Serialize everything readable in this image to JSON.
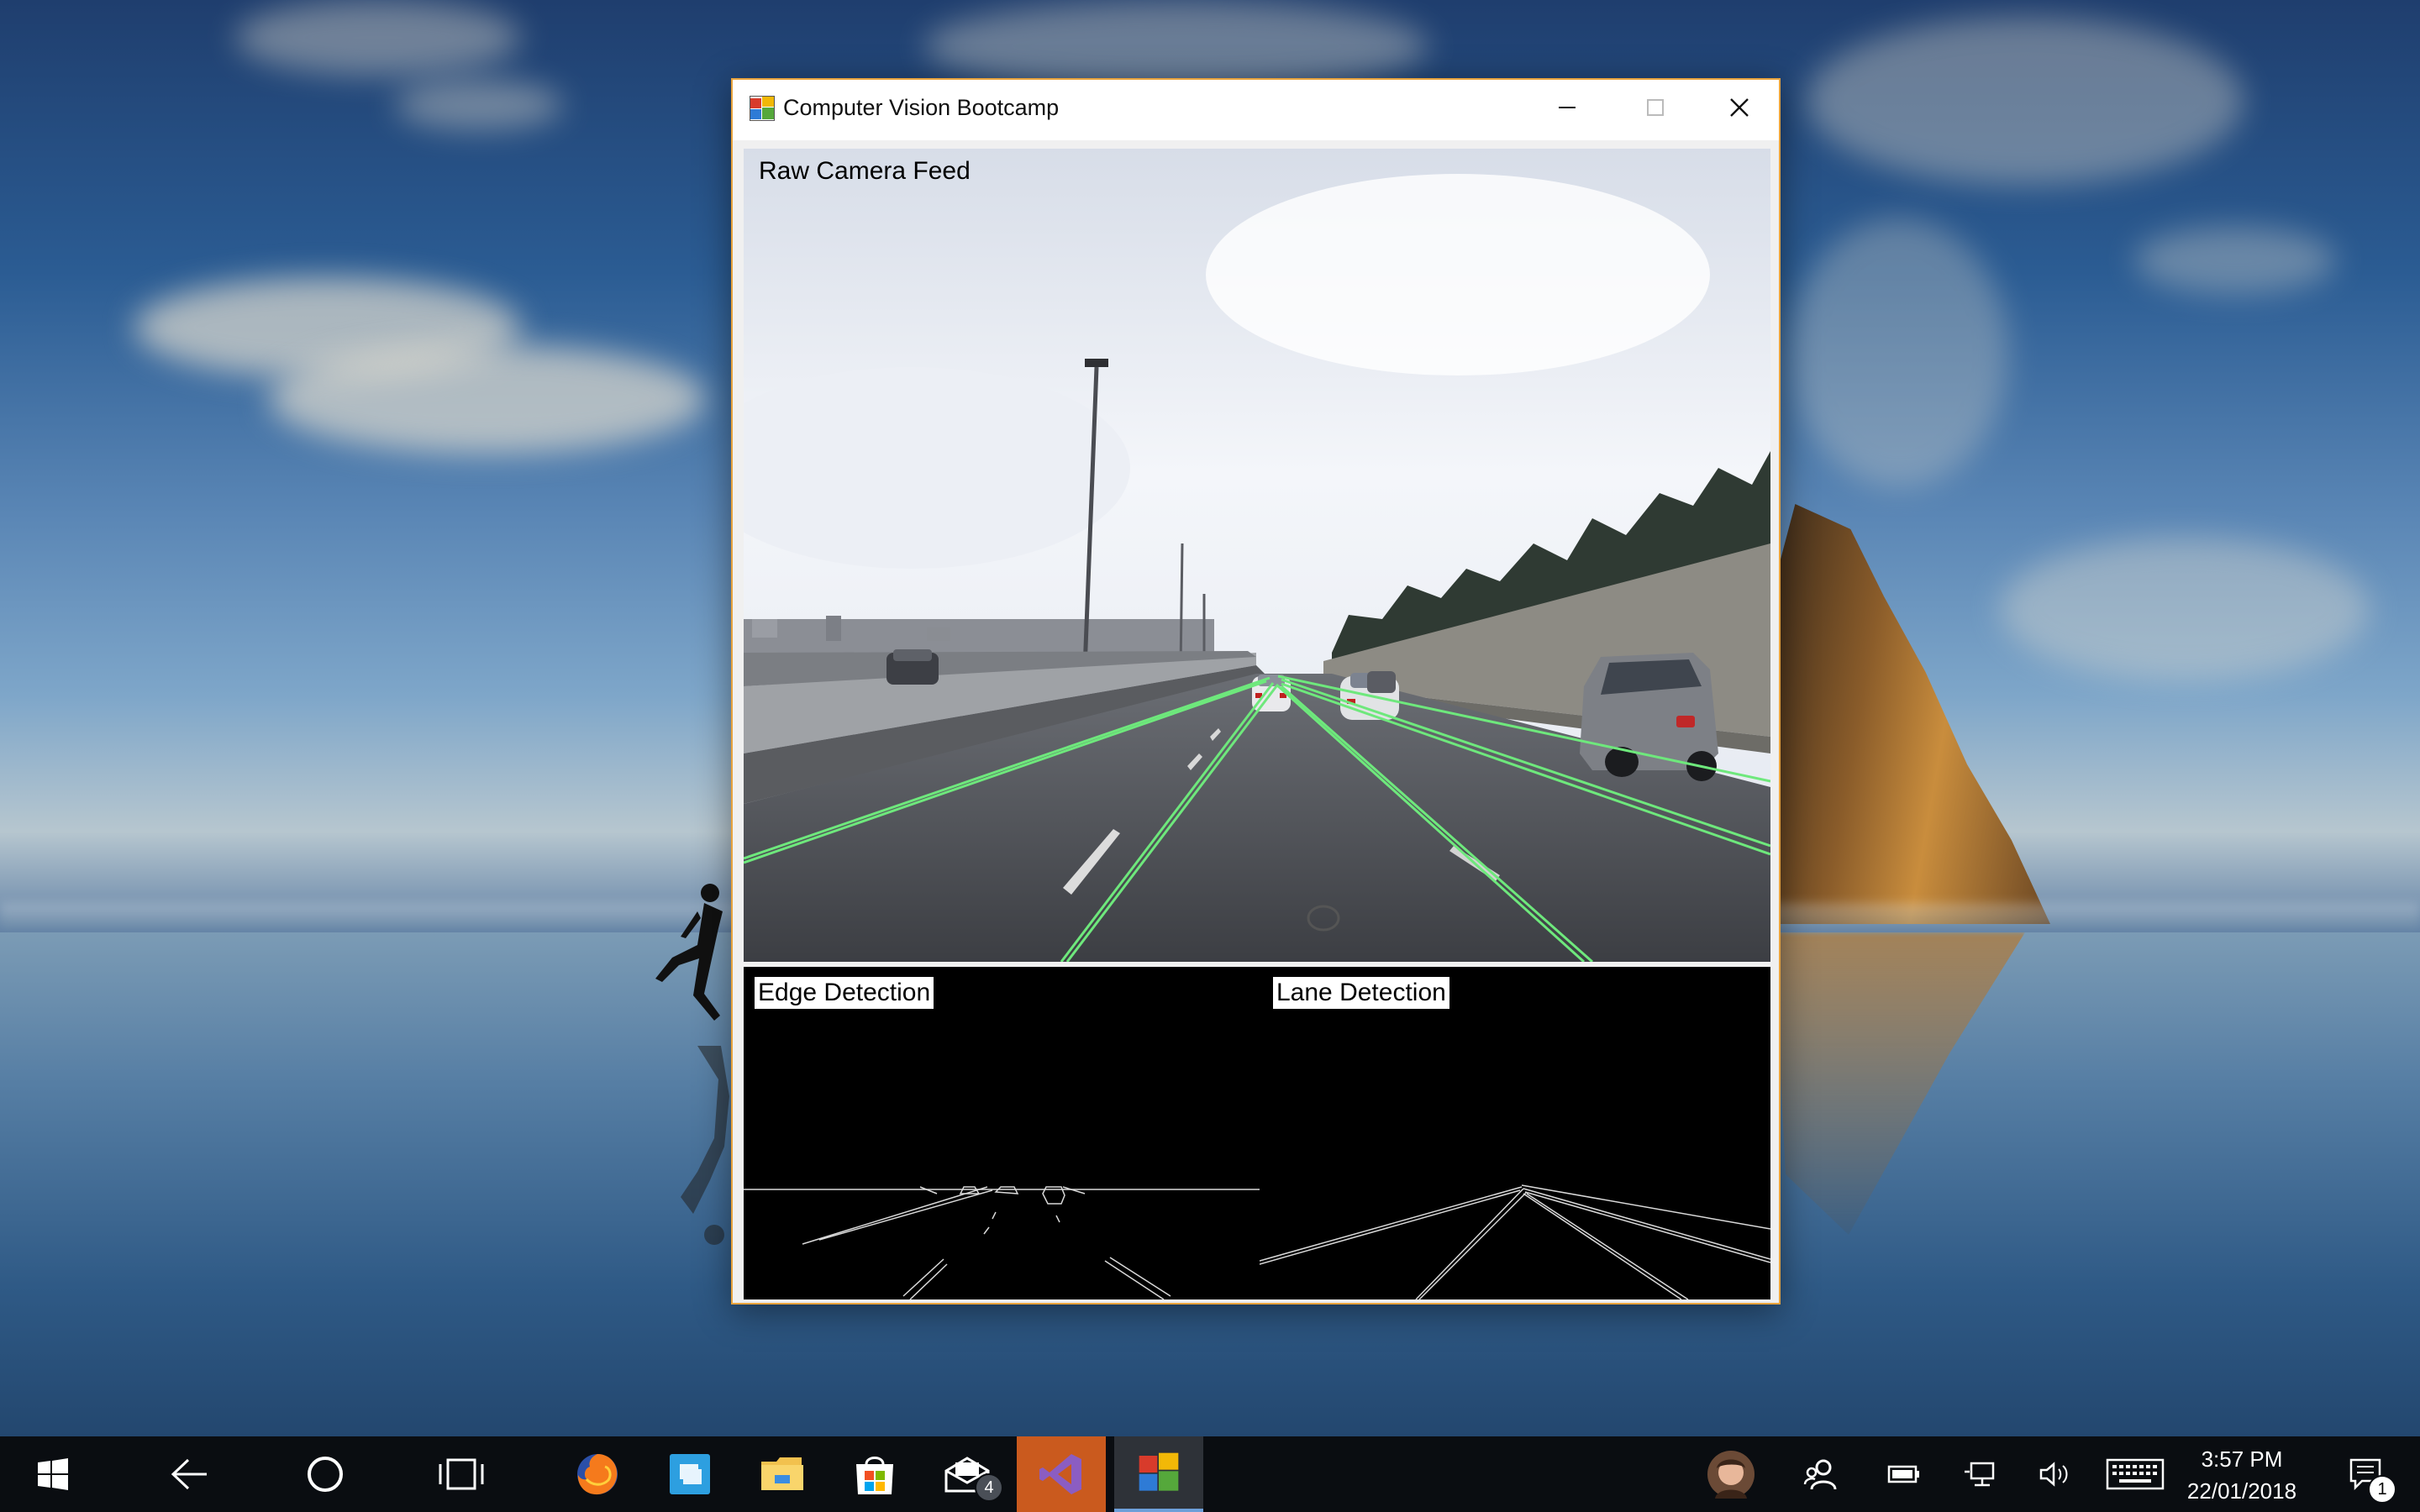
{
  "window": {
    "title": "Computer Vision Bootcamp",
    "minimize_icon": "minimize-icon",
    "maximize_icon": "maximize-icon",
    "close_icon": "close-icon"
  },
  "panels": {
    "raw_feed_label": "Raw Camera Feed",
    "edge_label": "Edge Detection",
    "lane_label": "Lane Detection"
  },
  "colors": {
    "window_border": "#e8a33d",
    "lane_line": "#6ee87c",
    "taskbar_bg": "#0a0d11",
    "active_app": "#ca5a1e"
  },
  "taskbar": {
    "items": [
      {
        "name": "start-button",
        "icon": "windows-logo-icon"
      },
      {
        "name": "back-button",
        "icon": "back-arrow-icon"
      },
      {
        "name": "cortana-button",
        "icon": "cortana-circle-icon"
      },
      {
        "name": "task-view-button",
        "icon": "task-view-icon"
      },
      {
        "name": "firefox-app",
        "icon": "firefox-icon"
      },
      {
        "name": "files-app",
        "icon": "files-icon"
      },
      {
        "name": "file-explorer-app",
        "icon": "folder-icon"
      },
      {
        "name": "store-app",
        "icon": "store-icon"
      },
      {
        "name": "mail-app",
        "icon": "mail-icon"
      },
      {
        "name": "visual-studio-app",
        "icon": "visual-studio-icon"
      },
      {
        "name": "cv-bootcamp-app",
        "icon": "app-window-icon"
      }
    ],
    "mail_badge": "4",
    "tray": {
      "icons": [
        "avatar",
        "people-icon",
        "battery-icon",
        "network-icon",
        "volume-icon",
        "keyboard-icon"
      ],
      "time": "3:57 PM",
      "date": "22/01/2018",
      "notification_count": "1"
    }
  }
}
